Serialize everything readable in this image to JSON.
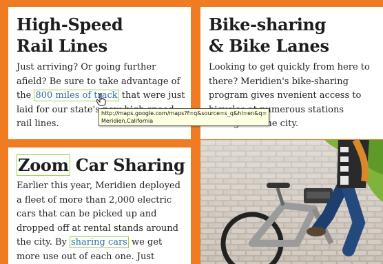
{
  "panels": {
    "rail": {
      "heading_line1": "High-Speed",
      "heading_line2": "Rail Lines",
      "text_before": "Just arriving? Or going further afield? Be sure to take advantage of the ",
      "link": "800 miles of track",
      "text_after": " that were just laid for our state's new high-speed rail lines."
    },
    "bike": {
      "heading_line1": "Bike-sharing",
      "heading_line2": "& Bike Lanes",
      "text": "Looking to get quickly from here to there? Meridien's bike-sharing program gives nvenient access to bicycles at numerous stations throughout the city."
    },
    "zoom": {
      "heading_word1": "Zoom",
      "heading_rest": " Car Sharing",
      "text_before": "Earlier this year, Meridien deployed a fleet of more than 2,000 electric cars that can be picked up and dropped off at rental stands around the city. By ",
      "link": "sharing cars",
      "text_after": " we get more use out of each one. Just"
    }
  },
  "tooltip": {
    "line1": "http://maps.google.com/maps?f=q&source=s_q&hl=en&q=",
    "line2": "Meridien,California"
  },
  "colors": {
    "accent_orange": "#ef7b22",
    "highlight_green": "#9ccf4a"
  }
}
